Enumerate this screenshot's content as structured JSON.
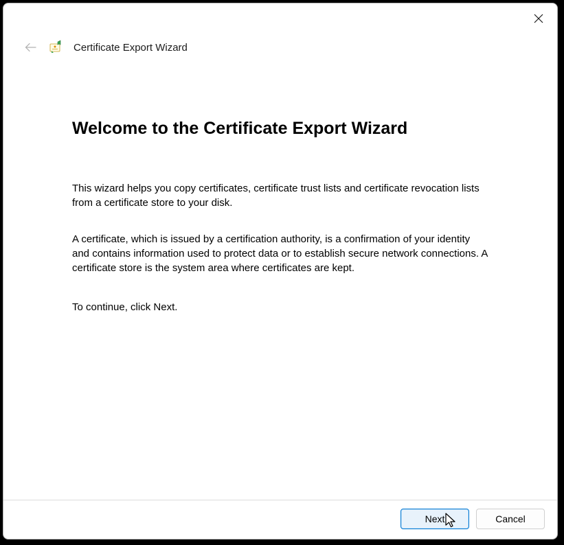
{
  "header": {
    "title": "Certificate Export Wizard"
  },
  "content": {
    "heading": "Welcome to the Certificate Export Wizard",
    "para1": "This wizard helps you copy certificates, certificate trust lists and certificate revocation lists from a certificate store to your disk.",
    "para2": "A certificate, which is issued by a certification authority, is a confirmation of your identity and contains information used to protect data or to establish secure network connections. A certificate store is the system area where certificates are kept.",
    "para3": "To continue, click Next."
  },
  "footer": {
    "next_label": "Next",
    "cancel_label": "Cancel"
  }
}
